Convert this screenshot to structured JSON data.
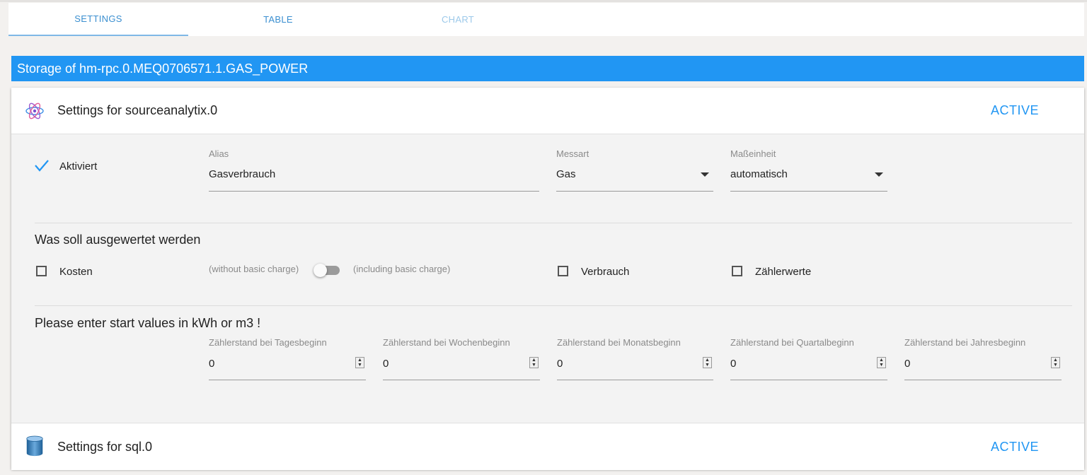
{
  "tabs": [
    {
      "label": "SETTINGS"
    },
    {
      "label": "TABLE"
    },
    {
      "label": "CHART"
    }
  ],
  "banner": {
    "title": "Storage of hm-rpc.0.MEQ0706571.1.GAS_POWER"
  },
  "sourceanalytix": {
    "title": "Settings for sourceanalytix.0",
    "status": "ACTIVE",
    "icon": "atom-icon",
    "enabled": {
      "label": "Aktiviert",
      "checked": true
    },
    "alias": {
      "label": "Alias",
      "value": "Gasverbrauch"
    },
    "messart": {
      "label": "Messart",
      "value": "Gas"
    },
    "masseinheit": {
      "label": "Maßeinheit",
      "value": "automatisch"
    },
    "evaluate": {
      "title": "Was soll ausgewertet werden",
      "kosten": {
        "label": "Kosten",
        "checked": false
      },
      "charge_without": "(without basic charge)",
      "charge_with": "(including basic charge)",
      "charge_toggle_on": false,
      "verbrauch": {
        "label": "Verbrauch",
        "checked": false
      },
      "zaehlerwerte": {
        "label": "Zählerwerte",
        "checked": false
      }
    },
    "start_values": {
      "title": "Please enter start values in kWh or m3 !",
      "fields": [
        {
          "label": "Zählerstand bei Tagesbeginn",
          "value": "0"
        },
        {
          "label": "Zählerstand bei Wochenbeginn",
          "value": "0"
        },
        {
          "label": "Zählerstand bei Monatsbeginn",
          "value": "0"
        },
        {
          "label": "Zählerstand bei Quartalbeginn",
          "value": "0"
        },
        {
          "label": "Zählerstand bei Jahresbeginn",
          "value": "0"
        }
      ]
    }
  },
  "sql": {
    "title": "Settings for sql.0",
    "status": "ACTIVE",
    "icon": "database-icon"
  },
  "colors": {
    "accent": "#2196f3",
    "tab_active": "#3b8fd0",
    "tab_disabled": "#9cc9ea"
  }
}
